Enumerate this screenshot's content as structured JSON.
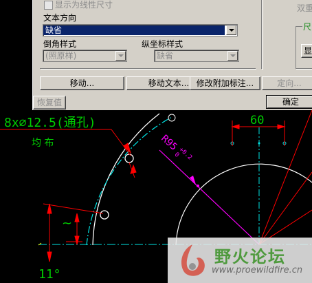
{
  "dialog": {
    "show_linear_label": "显示为线性尺寸",
    "text_direction_label": "文本方向",
    "text_direction_value": "缺省",
    "chamfer_style_label": "倒角样式",
    "chamfer_style_value": "(照原样)",
    "ordinate_style_label": "纵坐标样式",
    "ordinate_style_value": "缺省",
    "right_partial_1": "双重",
    "right_partial_2": "尺",
    "right_partial_3": "显",
    "buttons": {
      "move": "移动...",
      "move_text": "移动文本...",
      "modify_attach": "修改附加标注...",
      "orient": "定向...",
      "restore": "恢复值",
      "ok": "确定"
    }
  },
  "drawing": {
    "hole_spec": "8x∅12.5(通孔)",
    "equal_label": "均  布",
    "dim_60": "60",
    "dim_r95": "R95",
    "dim_r95_tol_upper": "+0.2",
    "dim_r95_tol_lower": "0",
    "dim_approx": "~",
    "dim_angle": "11°"
  },
  "colors": {
    "dim_red": "#ff0000",
    "text_green": "#00cc00",
    "dim_magenta": "#ff00ff",
    "geom_white": "#ffffff",
    "center_cyan": "#00ffff",
    "dim_yellow": "#ffff00"
  },
  "watermark": {
    "title": "野火论坛",
    "url": "www.proewildfire.cn"
  }
}
